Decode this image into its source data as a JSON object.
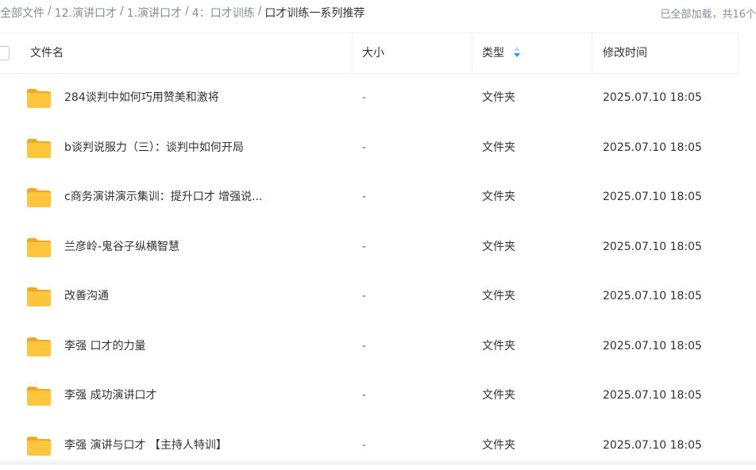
{
  "breadcrumb": {
    "items": [
      "全部文件",
      "12.演讲口才",
      "1.演讲口才",
      "4：口才训练"
    ],
    "current": "口才训练一系列推荐",
    "separator": "/"
  },
  "loaded_info": "已全部加载，共16个",
  "columns": {
    "name": "文件名",
    "size": "大小",
    "type": "类型",
    "modified": "修改时间"
  },
  "rows": [
    {
      "name": "284谈判中如何巧用赞美和激将",
      "size": "-",
      "type": "文件夹",
      "modified": "2025.07.10 18:05"
    },
    {
      "name": "b谈判说服力（三）：谈判中如何开局",
      "size": "-",
      "type": "文件夹",
      "modified": "2025.07.10 18:05"
    },
    {
      "name": "c商务演讲演示集训：提升口才 增强说...",
      "size": "-",
      "type": "文件夹",
      "modified": "2025.07.10 18:05"
    },
    {
      "name": "兰彦岭-鬼谷子纵横智慧",
      "size": "-",
      "type": "文件夹",
      "modified": "2025.07.10 18:05"
    },
    {
      "name": "改善沟通",
      "size": "-",
      "type": "文件夹",
      "modified": "2025.07.10 18:05"
    },
    {
      "name": "李强 口才的力量",
      "size": "-",
      "type": "文件夹",
      "modified": "2025.07.10 18:05"
    },
    {
      "name": "李强 成功演讲口才",
      "size": "-",
      "type": "文件夹",
      "modified": "2025.07.10 18:05"
    },
    {
      "name": "李强 演讲与口才 【主持人特训】",
      "size": "-",
      "type": "文件夹",
      "modified": "2025.07.10 18:05"
    }
  ],
  "icons": {
    "folder": "folder-icon",
    "sort": "sort-icon",
    "checkbox": "checkbox"
  },
  "colors": {
    "folder_body": "#ffc53d",
    "folder_tab": "#f5a623",
    "sort_active": "#06a7ff",
    "muted_text": "#878c9c"
  }
}
